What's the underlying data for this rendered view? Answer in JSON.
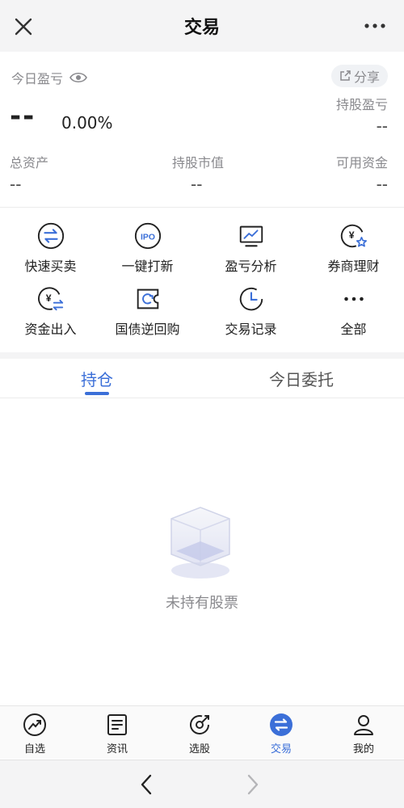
{
  "header": {
    "title": "交易"
  },
  "summary": {
    "today_pl_label": "今日盈亏",
    "share_label": "分享",
    "today_pl_value": "--",
    "today_pl_percent": "0.00%",
    "holding_pl_label": "持股盈亏",
    "holding_pl_value": "--",
    "total_assets_label": "总资产",
    "total_assets_value": "--",
    "holding_value_label": "持股市值",
    "holding_value_value": "--",
    "available_funds_label": "可用资金",
    "available_funds_value": "--"
  },
  "quick_actions": [
    {
      "label": "快速买卖",
      "icon": "swap-icon"
    },
    {
      "label": "一键打新",
      "icon": "ipo-icon"
    },
    {
      "label": "盈亏分析",
      "icon": "chart-monitor-icon"
    },
    {
      "label": "券商理财",
      "icon": "yen-star-icon"
    },
    {
      "label": "资金出入",
      "icon": "yen-transfer-icon"
    },
    {
      "label": "国债逆回购",
      "icon": "bond-repo-icon"
    },
    {
      "label": "交易记录",
      "icon": "clock-icon"
    },
    {
      "label": "全部",
      "icon": "more-dots-icon"
    }
  ],
  "tabs": [
    {
      "label": "持仓",
      "active": true
    },
    {
      "label": "今日委托",
      "active": false
    }
  ],
  "empty_state": {
    "text": "未持有股票",
    "icon": "empty-box-icon"
  },
  "bottom_nav": [
    {
      "label": "自选",
      "icon": "trend-icon",
      "active": false
    },
    {
      "label": "资讯",
      "icon": "news-icon",
      "active": false
    },
    {
      "label": "选股",
      "icon": "stock-pick-icon",
      "active": false
    },
    {
      "label": "交易",
      "icon": "trade-icon",
      "active": true
    },
    {
      "label": "我的",
      "icon": "user-icon",
      "active": false
    }
  ],
  "colors": {
    "accent": "#3b6fd8",
    "muted": "#8a8a8e",
    "header_bg": "#f4f4f5"
  }
}
